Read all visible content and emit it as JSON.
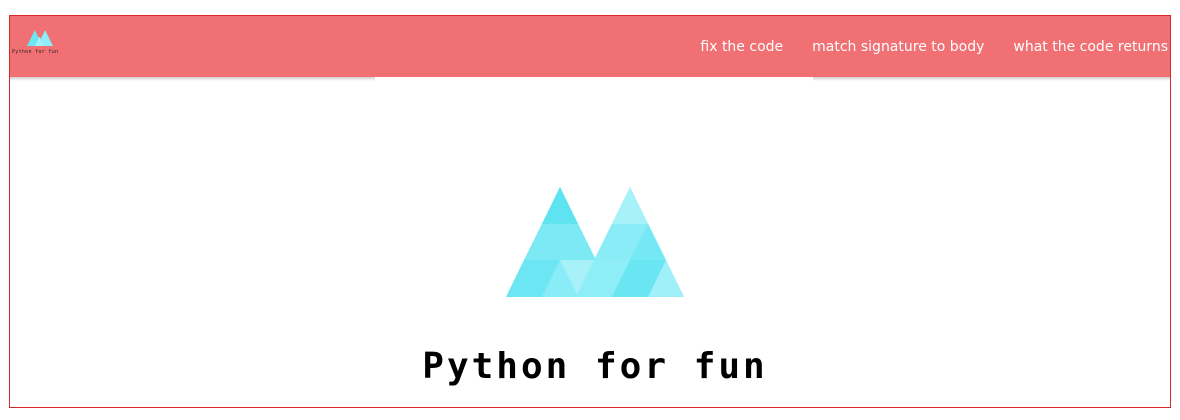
{
  "brand": {
    "logo_icon": "triangle-m-logo-icon",
    "text": "Python for fun"
  },
  "nav": {
    "items": [
      {
        "label": "fix the code"
      },
      {
        "label": "match signature to body"
      },
      {
        "label": "what the code returns"
      }
    ]
  },
  "hero": {
    "logo_icon": "triangle-m-logo-icon",
    "title": "Python for fun"
  },
  "colors": {
    "navbar": "#f07074",
    "frame_border": "#d62828",
    "logo_cyan": "#67e8f9"
  }
}
